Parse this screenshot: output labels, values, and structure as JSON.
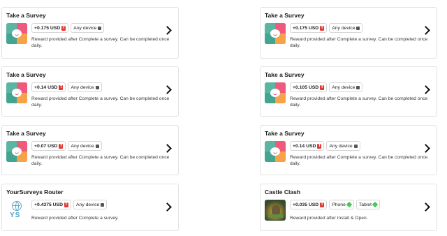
{
  "offers": [
    {
      "title": "Take a Survey",
      "reward": "+0.175 USD",
      "devices": [
        "Any device"
      ],
      "description": "Reward provided after Complete a survey. Can be completed once daily.",
      "icon": "survey-icon"
    },
    {
      "title": "Take a Survey",
      "reward": "+0.175 USD",
      "devices": [
        "Any device"
      ],
      "description": "Reward provided after Complete a survey. Can be completed once daily.",
      "icon": "survey-icon"
    },
    {
      "title": "Take a Survey",
      "reward": "+0.14 USD",
      "devices": [
        "Any device"
      ],
      "description": "Reward provided after Complete a survey. Can be completed once daily.",
      "icon": "survey-icon"
    },
    {
      "title": "Take a Survey",
      "reward": "+0.105 USD",
      "devices": [
        "Any device"
      ],
      "description": "Reward provided after Complete a survey. Can be completed once daily.",
      "icon": "survey-icon"
    },
    {
      "title": "Take a Survey",
      "reward": "+0.07 USD",
      "devices": [
        "Any device"
      ],
      "description": "Reward provided after Complete a survey. Can be completed once daily.",
      "icon": "survey-icon"
    },
    {
      "title": "Take a Survey",
      "reward": "+0.14 USD",
      "devices": [
        "Any device"
      ],
      "description": "Reward provided after Complete a survey. Can be completed once daily.",
      "icon": "survey-icon"
    },
    {
      "title": "YourSurveys Router",
      "reward": "+0.4375 USD",
      "devices": [
        "Any device"
      ],
      "description": "Reward provided after Complete a survey.",
      "icon": "yoursurveys-logo-icon",
      "icon_text": "YS"
    },
    {
      "title": "Castle Clash",
      "reward": "+0.035 USD",
      "devices": [
        "Phone",
        "Tablet"
      ],
      "description": "Reward provided after Install & Open.",
      "icon": "castle-clash-game-icon"
    }
  ]
}
